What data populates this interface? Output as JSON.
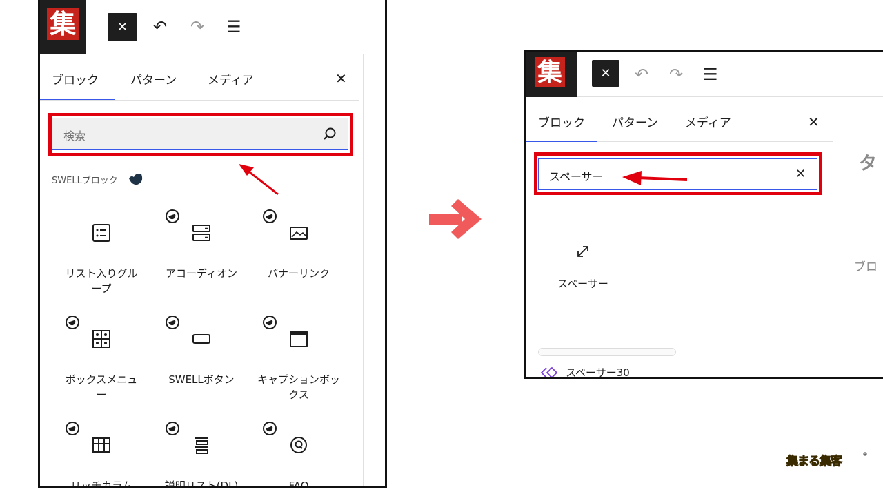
{
  "left_panel": {
    "logo_text": "集",
    "tabs": [
      "ブロック",
      "パターン",
      "メディア"
    ],
    "search": {
      "placeholder": "検索"
    },
    "section_title": "SWELLブロック",
    "blocks": [
      {
        "label": "リスト入りグループ",
        "icon": "list-group-icon",
        "swell": false
      },
      {
        "label": "アコーディオン",
        "icon": "accordion-icon",
        "swell": true
      },
      {
        "label": "バナーリンク",
        "icon": "banner-link-icon",
        "swell": true
      },
      {
        "label": "ボックスメニュー",
        "icon": "box-menu-icon",
        "swell": true
      },
      {
        "label": "SWELLボタン",
        "icon": "button-icon",
        "swell": true
      },
      {
        "label": "キャプションボックス",
        "icon": "caption-box-icon",
        "swell": true
      },
      {
        "label": "リッチカラム",
        "icon": "rich-column-icon",
        "swell": true
      },
      {
        "label": "説明リスト(DL)",
        "icon": "description-list-icon",
        "swell": true
      },
      {
        "label": "FAQ",
        "icon": "faq-icon",
        "swell": true
      }
    ]
  },
  "right_panel": {
    "logo_text": "集",
    "tabs": [
      "ブロック",
      "パターン",
      "メディア"
    ],
    "search": {
      "value": "スペーサー"
    },
    "result_label": "スペーサー",
    "pattern_label": "スペーサー30",
    "canvas_partial_title": "タ",
    "canvas_partial_text": "ブロ"
  },
  "colors": {
    "highlight": "#e1000e",
    "arrow_transition": "#f05a5a",
    "accent": "#3858e9"
  },
  "watermark": {
    "text": "集まる集客"
  }
}
